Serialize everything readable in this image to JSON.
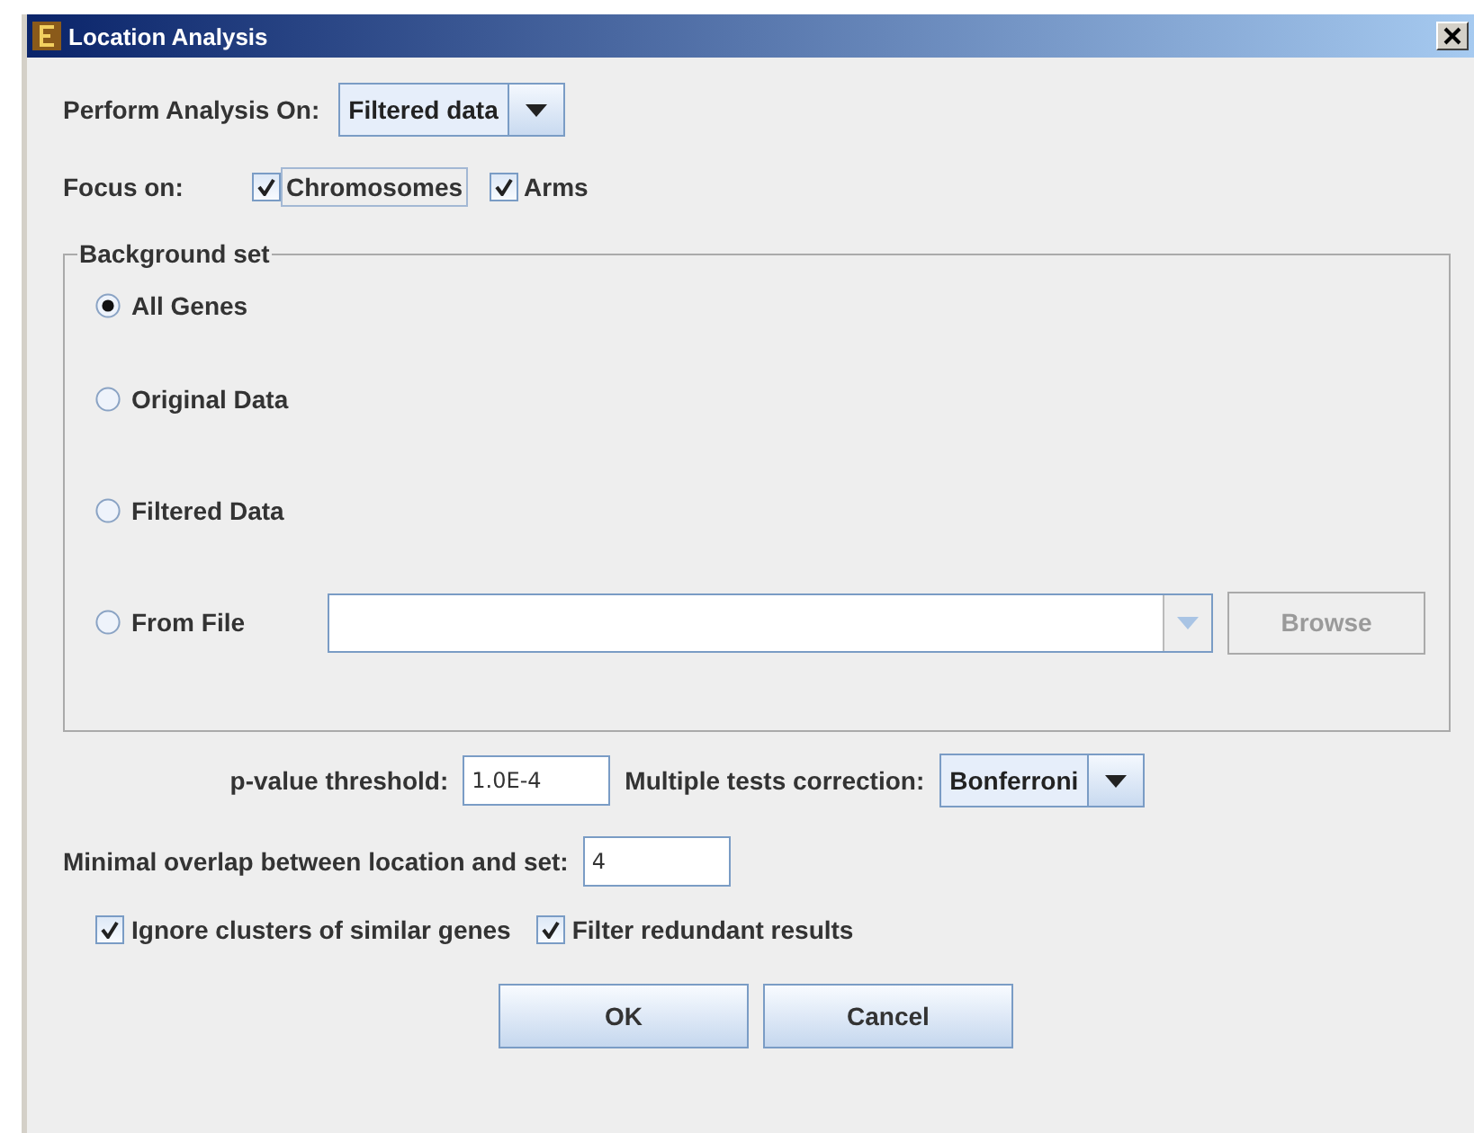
{
  "window": {
    "title": "Location Analysis"
  },
  "perform_analysis": {
    "label": "Perform Analysis On:",
    "value": "Filtered data"
  },
  "focus": {
    "label": "Focus on:",
    "options": [
      {
        "label": "Chromosomes",
        "checked": true,
        "focused": true
      },
      {
        "label": "Arms",
        "checked": true,
        "focused": false
      }
    ]
  },
  "background_set": {
    "title": "Background set",
    "options": [
      {
        "label": "All Genes",
        "selected": true
      },
      {
        "label": "Original Data",
        "selected": false
      },
      {
        "label": "Filtered Data",
        "selected": false
      },
      {
        "label": "From File",
        "selected": false
      }
    ],
    "browse_button": {
      "label": "Browse",
      "disabled": true
    }
  },
  "p_value": {
    "label": "p-value threshold:",
    "value": "1.0E-4"
  },
  "correction": {
    "label": "Multiple tests correction:",
    "value": "Bonferroni"
  },
  "overlap": {
    "label": "Minimal overlap between location and set:",
    "value": "4"
  },
  "options": [
    {
      "label": "Ignore clusters of similar genes",
      "checked": true
    },
    {
      "label": "Filter redundant results",
      "checked": true
    }
  ],
  "buttons": [
    {
      "label": "OK"
    },
    {
      "label": "Cancel"
    }
  ]
}
